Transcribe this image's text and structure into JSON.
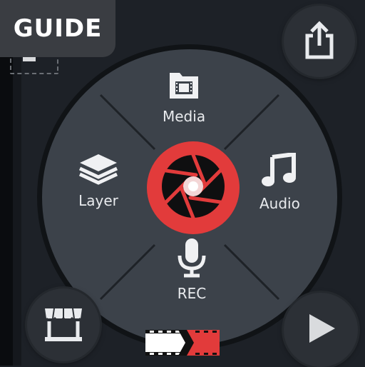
{
  "badge": {
    "label": "GUIDE"
  },
  "menu": {
    "media_label": "Media",
    "layer_label": "Layer",
    "audio_label": "Audio",
    "rec_label": "REC"
  },
  "icons": {
    "share": "share-icon",
    "store": "store-icon",
    "play": "play-icon",
    "record_center": "shutter-icon",
    "media": "media-folder-icon",
    "layer": "layers-icon",
    "audio": "music-note-icon",
    "rec": "microphone-icon",
    "film": "film-strip-icon"
  },
  "colors": {
    "background": "#1d2127",
    "wheel": "#3c424a",
    "accent_red": "#e23b3b",
    "text": "#e9ebee"
  }
}
